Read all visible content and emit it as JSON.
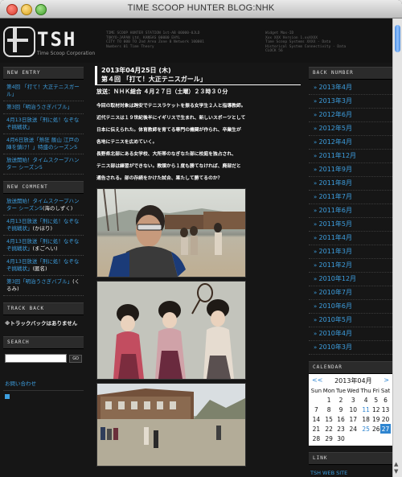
{
  "window": {
    "title": "TIME SCOOP HUNTER BLOG:NHK"
  },
  "header": {
    "logo_text": "TSH",
    "logo_sub": "Time Scoop Corporation",
    "info_col1": "TIME SCOOP HUNTER STATION 1st-AB 00000-0JLD\nTOKYO-JAPAN Ltd. KANSAS 00000 EHYL\nCITY TO 000 TO 2nd Area Zone 0 Network 100001\nNumbers 01 Time Theory",
    "info_col2": "Widget Max-ID\nXxx XXX Version 1.xxXXXX\nTime Scoop Systems XXXX - Data\nHistorical System Connectivity - Data\nCLOCK 56"
  },
  "sidebar_left": {
    "new_entry": {
      "heading": "NEW ENTRY",
      "items": [
        "第4回 「打て！大正テニスガール」",
        "第3回「明治うさぎバブル」",
        "4月13日放送「刑に処！なぞなぞ挑戦状」",
        "4月6日放送「熱狂 飯山 江戸の陣を鎮け！」特盛のシーズン5",
        "放送開始！タイムスクープハンター シーズン5"
      ]
    },
    "new_comment": {
      "heading": "NEW COMMENT",
      "items": [
        {
          "text": "放送開始！タイムスクープハンター シーズン5",
          "by": "(海のしずく)"
        },
        {
          "text": "4月13日放送「刑に処！なぞなぞ挑戦状」",
          "by": "(かほり)"
        },
        {
          "text": "4月13日放送「刑に処！なぞなぞ挑戦状」",
          "by": "(まごへい)"
        },
        {
          "text": "4月13日放送「刑に処！なぞなぞ挑戦状」",
          "by": "(匿名)"
        },
        {
          "text": "第3回「明治うさぎバブル」",
          "by": "(くるみ)"
        }
      ]
    },
    "trackback": {
      "heading": "TRACK BACK",
      "note": "※トラックバックはありません"
    },
    "search": {
      "heading": "SEARCH",
      "button": "GO"
    },
    "contact_link": "お問い合わせ"
  },
  "post": {
    "date": "2013年04月25日 (木)",
    "title": "第４回 「打て！大正テニスガール」",
    "broadcast": "放送：ＮＨＫ総合 ４月２７日（土曜）２３時３０分",
    "paragraphs": [
      "今回の取材対象は跨安でテニスラケットを振る女学生２人と指導教師。",
      "近代テニスは１９世紀後半にイギリスで生まれ、新しいスポーツとして",
      "日本に伝えられた。体育教師を育てる専門の機関が作られ、卒業生が",
      "各地にテニスを広めていく。",
      "長野県北部にある女学校、大所帯のなぎなた部に校庭を独占され、",
      "テニス部は練習ができない。教頭から１度も勝てなければ、廃部だと",
      "通告される。部の存続をかけた試合、果たして勝てるのか？"
    ]
  },
  "sidebar_right": {
    "back_number": {
      "heading": "BACK NUMBER",
      "items": [
        "2013年4月",
        "2013年3月",
        "2012年6月",
        "2012年5月",
        "2012年4月",
        "2011年12月",
        "2011年9月",
        "2011年8月",
        "2011年7月",
        "2011年6月",
        "2011年5月",
        "2011年4月",
        "2011年3月",
        "2011年2月",
        "2010年12月",
        "2010年7月",
        "2010年6月",
        "2010年5月",
        "2010年4月",
        "2010年3月"
      ]
    },
    "calendar": {
      "heading": "CALENDAR",
      "prev": "<<",
      "month": "2013年04月",
      "next": ">",
      "days": [
        "Sun",
        "Mon",
        "Tue",
        "Wed",
        "Thu",
        "Fri",
        "Sat"
      ],
      "weeks": [
        [
          "",
          "1",
          "2",
          "3",
          "4",
          "5",
          "6"
        ],
        [
          "7",
          "8",
          "9",
          "10",
          "11",
          "12",
          "13"
        ],
        [
          "14",
          "15",
          "16",
          "17",
          "18",
          "19",
          "20"
        ],
        [
          "21",
          "22",
          "23",
          "24",
          "25",
          "26",
          "27"
        ],
        [
          "28",
          "29",
          "30",
          "",
          "",
          "",
          ""
        ]
      ],
      "linked": [
        "11",
        "25"
      ],
      "today": "27"
    },
    "link": {
      "heading": "LINK",
      "items": [
        "TSH WEB SITE"
      ]
    }
  }
}
